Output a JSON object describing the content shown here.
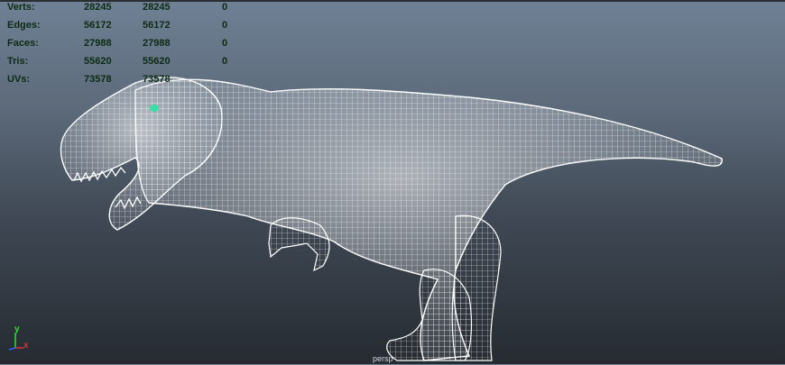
{
  "hud": {
    "rows": [
      {
        "label": "Verts:",
        "v1": "28245",
        "v2": "28245",
        "v3": "0"
      },
      {
        "label": "Edges:",
        "v1": "56172",
        "v2": "56172",
        "v3": "0"
      },
      {
        "label": "Faces:",
        "v1": "27988",
        "v2": "27988",
        "v3": "0"
      },
      {
        "label": "Tris:",
        "v1": "55620",
        "v2": "55620",
        "v3": "0"
      },
      {
        "label": "UVs:",
        "v1": "73578",
        "v2": "73578",
        "v3": ""
      }
    ]
  },
  "axis": {
    "y": "y",
    "x": "x"
  },
  "camera_label": "persp",
  "colors": {
    "wire": "#ffffff",
    "hud_text": "#0c2b12",
    "eye_highlight": "#38e0a8",
    "axis_x": "#e03030",
    "axis_y": "#30e030",
    "axis_z": "#3060ff"
  }
}
